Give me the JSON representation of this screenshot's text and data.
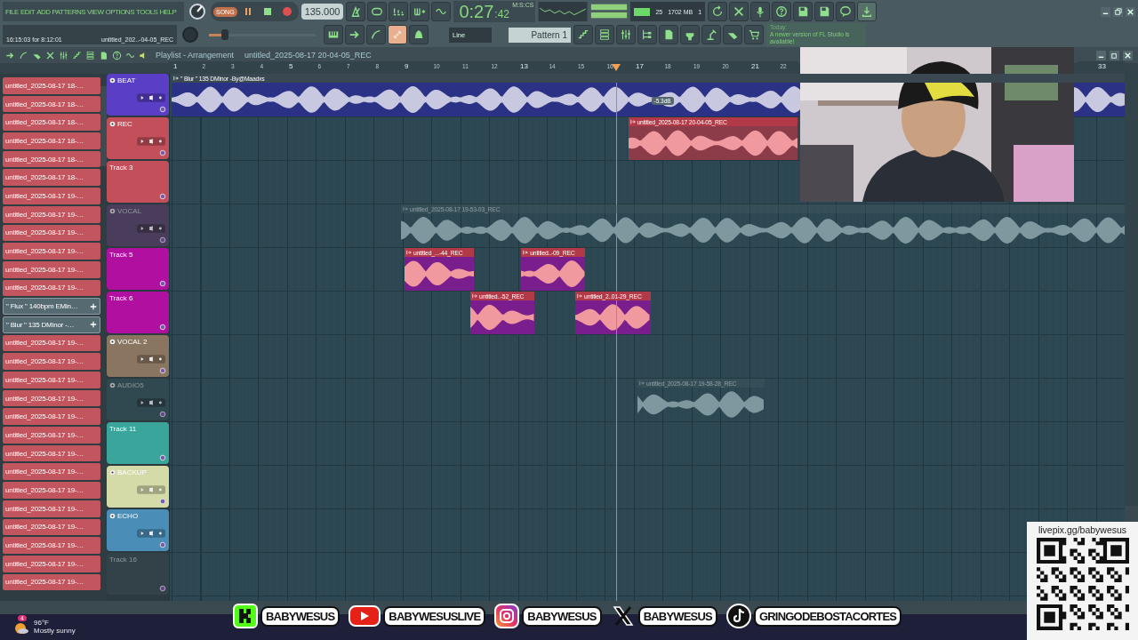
{
  "menu": [
    "FILE",
    "EDIT",
    "ADD",
    "PATTERNS",
    "VIEW",
    "OPTIONS",
    "TOOLS",
    "HELP"
  ],
  "transport": {
    "mode": "SONG",
    "tempo": "135.000"
  },
  "clock": {
    "time": "0:27",
    "centis": ":42",
    "unit": "M:S:CS"
  },
  "hint": {
    "time": "16:15:03 for 8:12:01",
    "file": "untitled_202..-04-05_REC"
  },
  "cpu": {
    "value": "25",
    "memory": "1702 MB",
    "voices": "1"
  },
  "pitch": {
    "level": 0.15
  },
  "snap": "Line",
  "pattern": "Pattern 1",
  "news": {
    "label": "Today:",
    "text": "A newer version of FL Studio is available!"
  },
  "playlist": {
    "title": "Playlist - Arrangement",
    "file": "untitled_2025-08-17 20-04-05_REC",
    "tooltip": "-5.3dB",
    "ruler": [
      "1",
      "2",
      "3",
      "4",
      "5",
      "6",
      "7",
      "8",
      "9",
      "10",
      "11",
      "12",
      "13",
      "14",
      "15",
      "16",
      "17",
      "18",
      "19",
      "20",
      "21",
      "22",
      "33"
    ],
    "patterns": [
      {
        "kind": "audio",
        "label": "untitled_2025-08-17 18-…"
      },
      {
        "kind": "audio",
        "label": "untitled_2025-08-17 18-…"
      },
      {
        "kind": "audio",
        "label": "untitled_2025-08-17 18-…"
      },
      {
        "kind": "audio",
        "label": "untitled_2025-08-17 18-…"
      },
      {
        "kind": "audio",
        "label": "untitled_2025-08-17 18-…"
      },
      {
        "kind": "audio",
        "label": "untitled_2025-08-17 18-…"
      },
      {
        "kind": "audio",
        "label": "untitled_2025-08-17 19-…"
      },
      {
        "kind": "audio",
        "label": "untitled_2025-08-17 19-…"
      },
      {
        "kind": "audio",
        "label": "untitled_2025-08-17 19-…"
      },
      {
        "kind": "audio",
        "label": "untitled_2025-08-17 19-…"
      },
      {
        "kind": "audio",
        "label": "untitled_2025-08-17 19-…"
      },
      {
        "kind": "audio",
        "label": "untitled_2025-08-17 19-…"
      },
      {
        "kind": "pattern",
        "label": "\" Flux \" 140bpm EMin…"
      },
      {
        "kind": "pattern",
        "label": "\" Blur \" 135 DMinor -…"
      },
      {
        "kind": "audio",
        "label": "untitled_2025-08-17 19-…"
      },
      {
        "kind": "audio",
        "label": "untitled_2025-08-17 19-…"
      },
      {
        "kind": "audio",
        "label": "untitled_2025-08-17 19-…"
      },
      {
        "kind": "audio",
        "label": "untitled_2025-08-17 19-…"
      },
      {
        "kind": "audio",
        "label": "untitled_2025-08-17 19-…"
      },
      {
        "kind": "audio",
        "label": "untitled_2025-08-17 19-…"
      },
      {
        "kind": "audio",
        "label": "untitled_2025-08-17 19-…"
      },
      {
        "kind": "audio",
        "label": "untitled_2025-08-17 19-…"
      },
      {
        "kind": "audio",
        "label": "untitled_2025-08-17 19-…"
      },
      {
        "kind": "audio",
        "label": "untitled_2025-08-17 19-…"
      },
      {
        "kind": "audio",
        "label": "untitled_2025-08-17 19-…"
      },
      {
        "kind": "audio",
        "label": "untitled_2025-08-17 19-…"
      },
      {
        "kind": "audio",
        "label": "untitled_2025-08-17 19-…"
      },
      {
        "kind": "audio",
        "label": "untitled_2025-08-17 19-…"
      }
    ],
    "tracks": [
      {
        "kind": "named",
        "name": "BEAT",
        "color": "#5a3ec6",
        "dimmed": false,
        "clips": [
          {
            "label": "\" Blur \" 135 DMinor -By@Maadxs",
            "color": "#2b3286"
          }
        ]
      },
      {
        "kind": "named",
        "name": "REC",
        "color": "#c24f5a",
        "dimmed": false,
        "clips": [
          {
            "label": "untitled_2025-08-17 20-04-05_REC",
            "color": "#8c3b48"
          }
        ]
      },
      {
        "kind": "plain",
        "name": "Track 3",
        "color": "#c24f5a",
        "dimmed": false
      },
      {
        "kind": "named",
        "name": "VOCAL",
        "color": "#5d4c72",
        "dimmed": true,
        "clips": [
          {
            "label": "untitled_2025-08-17 19-53-03_REC",
            "color": "#35505a"
          }
        ]
      },
      {
        "kind": "plain",
        "name": "Track 5",
        "color": "#b00fa0",
        "dimmed": false,
        "clips": [
          {
            "label": "untitled_...-44_REC",
            "color": "#7a1e8e"
          },
          {
            "label": "untitled..-09_REC",
            "color": "#7a1e8e"
          }
        ]
      },
      {
        "kind": "plain",
        "name": "Track 6",
        "color": "#b00fa0",
        "dimmed": false,
        "clips": [
          {
            "label": "untitled..-52_REC",
            "color": "#7a1e8e"
          },
          {
            "label": "untitled_2..01-29_REC",
            "color": "#7a1e8e"
          }
        ]
      },
      {
        "kind": "named",
        "name": "VOCAL 2",
        "color": "#8a7660",
        "dimmed": false
      },
      {
        "kind": "named",
        "name": "AUDIO5",
        "color": "#3c5a63",
        "dimmed": true,
        "clips": [
          {
            "label": "untitled_2025-08-17 19-58-28_REC",
            "color": "#31505a"
          }
        ]
      },
      {
        "kind": "plain",
        "name": "Track 11",
        "color": "#3aa59a",
        "dimmed": false
      },
      {
        "kind": "named",
        "name": "BACKUP",
        "color": "#d4daa8",
        "dimmed": false
      },
      {
        "kind": "named",
        "name": "ECHO",
        "color": "#4a8db6",
        "dimmed": false
      },
      {
        "kind": "plain",
        "name": "Track 16",
        "color": "#3f525a",
        "dimmed": true
      }
    ]
  },
  "stream": {
    "socials": [
      {
        "kind": "kick",
        "handle": "BABYWESUS"
      },
      {
        "kind": "youtube",
        "handle": "BABYWESUSLIVE"
      },
      {
        "kind": "instagram",
        "handle": "BABYWESUS"
      },
      {
        "kind": "x",
        "handle": "BABYWESUS"
      },
      {
        "kind": "tiktok",
        "handle": "GRINGODEBOSTACORTES"
      }
    ],
    "tip_url": "livepix.gg/babywesus"
  },
  "taskbar": {
    "badge": "4",
    "temperature": "96°F",
    "condition": "Mostly sunny"
  }
}
